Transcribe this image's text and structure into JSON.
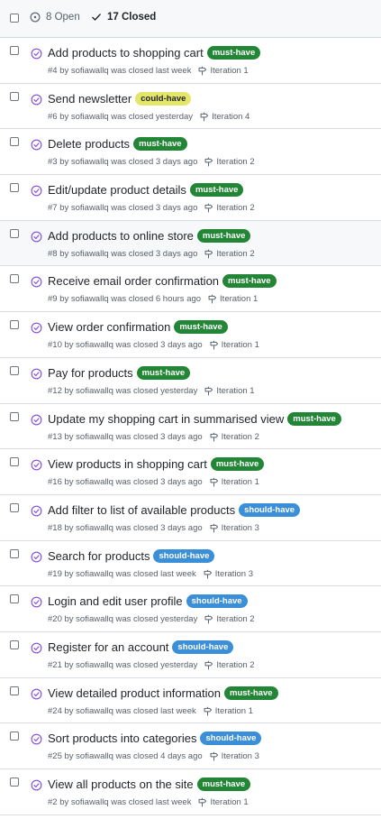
{
  "header": {
    "open_count_label": "8 Open",
    "closed_count_label": "17 Closed"
  },
  "label_styles": {
    "must-have": {
      "bg": "#238636",
      "fg": "#ffffff"
    },
    "could-have": {
      "bg": "#e4e669",
      "fg": "#1f2328"
    },
    "should-have": {
      "bg": "#3b8ed8",
      "fg": "#ffffff"
    }
  },
  "colors": {
    "done_purple": "#8250df",
    "muted": "#57606a"
  },
  "icons": {
    "open": "issue-opened-icon",
    "closed": "check-icon",
    "row_state": "issue-closed-icon",
    "milestone": "milestone-icon"
  },
  "issues": [
    {
      "title": "Add products to shopping cart",
      "label": "must-have",
      "meta": "#4 by sofiawallq was closed last week",
      "milestone": "Iteration 1"
    },
    {
      "title": "Send newsletter",
      "label": "could-have",
      "meta": "#6 by sofiawallq was closed yesterday",
      "milestone": "Iteration 4"
    },
    {
      "title": "Delete products",
      "label": "must-have",
      "meta": "#3 by sofiawallq was closed 3 days ago",
      "milestone": "Iteration 2"
    },
    {
      "title": "Edit/update product details",
      "label": "must-have",
      "meta": "#7 by sofiawallq was closed 3 days ago",
      "milestone": "Iteration 2"
    },
    {
      "title": "Add products to online store",
      "label": "must-have",
      "meta": "#8 by sofiawallq was closed 3 days ago",
      "milestone": "Iteration 2",
      "hover": true
    },
    {
      "title": "Receive email order confirmation",
      "label": "must-have",
      "meta": "#9 by sofiawallq was closed 6 hours ago",
      "milestone": "Iteration 1"
    },
    {
      "title": "View order confirmation",
      "label": "must-have",
      "meta": "#10 by sofiawallq was closed 3 days ago",
      "milestone": "Iteration 1"
    },
    {
      "title": "Pay for products",
      "label": "must-have",
      "meta": "#12 by sofiawallq was closed yesterday",
      "milestone": "Iteration 1"
    },
    {
      "title": "Update my shopping cart in summarised view",
      "label": "must-have",
      "meta": "#13 by sofiawallq was closed 3 days ago",
      "milestone": "Iteration 2"
    },
    {
      "title": "View products in shopping cart",
      "label": "must-have",
      "meta": "#16 by sofiawallq was closed 3 days ago",
      "milestone": "Iteration 1"
    },
    {
      "title": "Add filter to list of available products",
      "label": "should-have",
      "meta": "#18 by sofiawallq was closed 3 days ago",
      "milestone": "Iteration 3"
    },
    {
      "title": "Search for products",
      "label": "should-have",
      "meta": "#19 by sofiawallq was closed last week",
      "milestone": "Iteration 3"
    },
    {
      "title": "Login and edit user profile",
      "label": "should-have",
      "meta": "#20 by sofiawallq was closed yesterday",
      "milestone": "Iteration 2"
    },
    {
      "title": "Register for an account",
      "label": "should-have",
      "meta": "#21 by sofiawallq was closed yesterday",
      "milestone": "Iteration 2"
    },
    {
      "title": "View detailed product information",
      "label": "must-have",
      "meta": "#24 by sofiawallq was closed last week",
      "milestone": "Iteration 1"
    },
    {
      "title": "Sort products into categories",
      "label": "should-have",
      "meta": "#25 by sofiawallq was closed 4 days ago",
      "milestone": "Iteration 3"
    },
    {
      "title": "View all products on the site",
      "label": "must-have",
      "meta": "#2 by sofiawallq was closed last week",
      "milestone": "Iteration 1"
    }
  ]
}
